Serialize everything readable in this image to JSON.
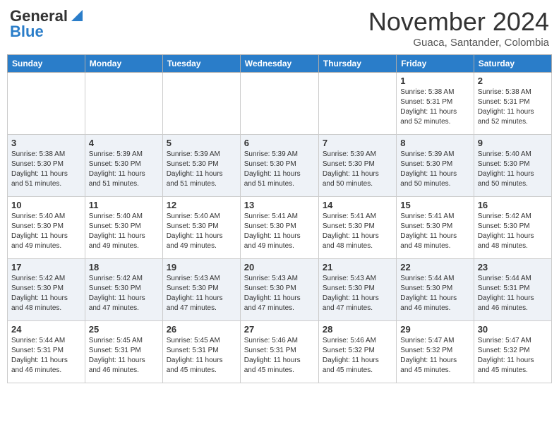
{
  "header": {
    "logo_general": "General",
    "logo_blue": "Blue",
    "month_title": "November 2024",
    "subtitle": "Guaca, Santander, Colombia"
  },
  "days_of_week": [
    "Sunday",
    "Monday",
    "Tuesday",
    "Wednesday",
    "Thursday",
    "Friday",
    "Saturday"
  ],
  "weeks": [
    [
      {
        "day": "",
        "info": ""
      },
      {
        "day": "",
        "info": ""
      },
      {
        "day": "",
        "info": ""
      },
      {
        "day": "",
        "info": ""
      },
      {
        "day": "",
        "info": ""
      },
      {
        "day": "1",
        "info": "Sunrise: 5:38 AM\nSunset: 5:31 PM\nDaylight: 11 hours\nand 52 minutes."
      },
      {
        "day": "2",
        "info": "Sunrise: 5:38 AM\nSunset: 5:31 PM\nDaylight: 11 hours\nand 52 minutes."
      }
    ],
    [
      {
        "day": "3",
        "info": "Sunrise: 5:38 AM\nSunset: 5:30 PM\nDaylight: 11 hours\nand 51 minutes."
      },
      {
        "day": "4",
        "info": "Sunrise: 5:39 AM\nSunset: 5:30 PM\nDaylight: 11 hours\nand 51 minutes."
      },
      {
        "day": "5",
        "info": "Sunrise: 5:39 AM\nSunset: 5:30 PM\nDaylight: 11 hours\nand 51 minutes."
      },
      {
        "day": "6",
        "info": "Sunrise: 5:39 AM\nSunset: 5:30 PM\nDaylight: 11 hours\nand 51 minutes."
      },
      {
        "day": "7",
        "info": "Sunrise: 5:39 AM\nSunset: 5:30 PM\nDaylight: 11 hours\nand 50 minutes."
      },
      {
        "day": "8",
        "info": "Sunrise: 5:39 AM\nSunset: 5:30 PM\nDaylight: 11 hours\nand 50 minutes."
      },
      {
        "day": "9",
        "info": "Sunrise: 5:40 AM\nSunset: 5:30 PM\nDaylight: 11 hours\nand 50 minutes."
      }
    ],
    [
      {
        "day": "10",
        "info": "Sunrise: 5:40 AM\nSunset: 5:30 PM\nDaylight: 11 hours\nand 49 minutes."
      },
      {
        "day": "11",
        "info": "Sunrise: 5:40 AM\nSunset: 5:30 PM\nDaylight: 11 hours\nand 49 minutes."
      },
      {
        "day": "12",
        "info": "Sunrise: 5:40 AM\nSunset: 5:30 PM\nDaylight: 11 hours\nand 49 minutes."
      },
      {
        "day": "13",
        "info": "Sunrise: 5:41 AM\nSunset: 5:30 PM\nDaylight: 11 hours\nand 49 minutes."
      },
      {
        "day": "14",
        "info": "Sunrise: 5:41 AM\nSunset: 5:30 PM\nDaylight: 11 hours\nand 48 minutes."
      },
      {
        "day": "15",
        "info": "Sunrise: 5:41 AM\nSunset: 5:30 PM\nDaylight: 11 hours\nand 48 minutes."
      },
      {
        "day": "16",
        "info": "Sunrise: 5:42 AM\nSunset: 5:30 PM\nDaylight: 11 hours\nand 48 minutes."
      }
    ],
    [
      {
        "day": "17",
        "info": "Sunrise: 5:42 AM\nSunset: 5:30 PM\nDaylight: 11 hours\nand 48 minutes."
      },
      {
        "day": "18",
        "info": "Sunrise: 5:42 AM\nSunset: 5:30 PM\nDaylight: 11 hours\nand 47 minutes."
      },
      {
        "day": "19",
        "info": "Sunrise: 5:43 AM\nSunset: 5:30 PM\nDaylight: 11 hours\nand 47 minutes."
      },
      {
        "day": "20",
        "info": "Sunrise: 5:43 AM\nSunset: 5:30 PM\nDaylight: 11 hours\nand 47 minutes."
      },
      {
        "day": "21",
        "info": "Sunrise: 5:43 AM\nSunset: 5:30 PM\nDaylight: 11 hours\nand 47 minutes."
      },
      {
        "day": "22",
        "info": "Sunrise: 5:44 AM\nSunset: 5:30 PM\nDaylight: 11 hours\nand 46 minutes."
      },
      {
        "day": "23",
        "info": "Sunrise: 5:44 AM\nSunset: 5:31 PM\nDaylight: 11 hours\nand 46 minutes."
      }
    ],
    [
      {
        "day": "24",
        "info": "Sunrise: 5:44 AM\nSunset: 5:31 PM\nDaylight: 11 hours\nand 46 minutes."
      },
      {
        "day": "25",
        "info": "Sunrise: 5:45 AM\nSunset: 5:31 PM\nDaylight: 11 hours\nand 46 minutes."
      },
      {
        "day": "26",
        "info": "Sunrise: 5:45 AM\nSunset: 5:31 PM\nDaylight: 11 hours\nand 45 minutes."
      },
      {
        "day": "27",
        "info": "Sunrise: 5:46 AM\nSunset: 5:31 PM\nDaylight: 11 hours\nand 45 minutes."
      },
      {
        "day": "28",
        "info": "Sunrise: 5:46 AM\nSunset: 5:32 PM\nDaylight: 11 hours\nand 45 minutes."
      },
      {
        "day": "29",
        "info": "Sunrise: 5:47 AM\nSunset: 5:32 PM\nDaylight: 11 hours\nand 45 minutes."
      },
      {
        "day": "30",
        "info": "Sunrise: 5:47 AM\nSunset: 5:32 PM\nDaylight: 11 hours\nand 45 minutes."
      }
    ]
  ]
}
